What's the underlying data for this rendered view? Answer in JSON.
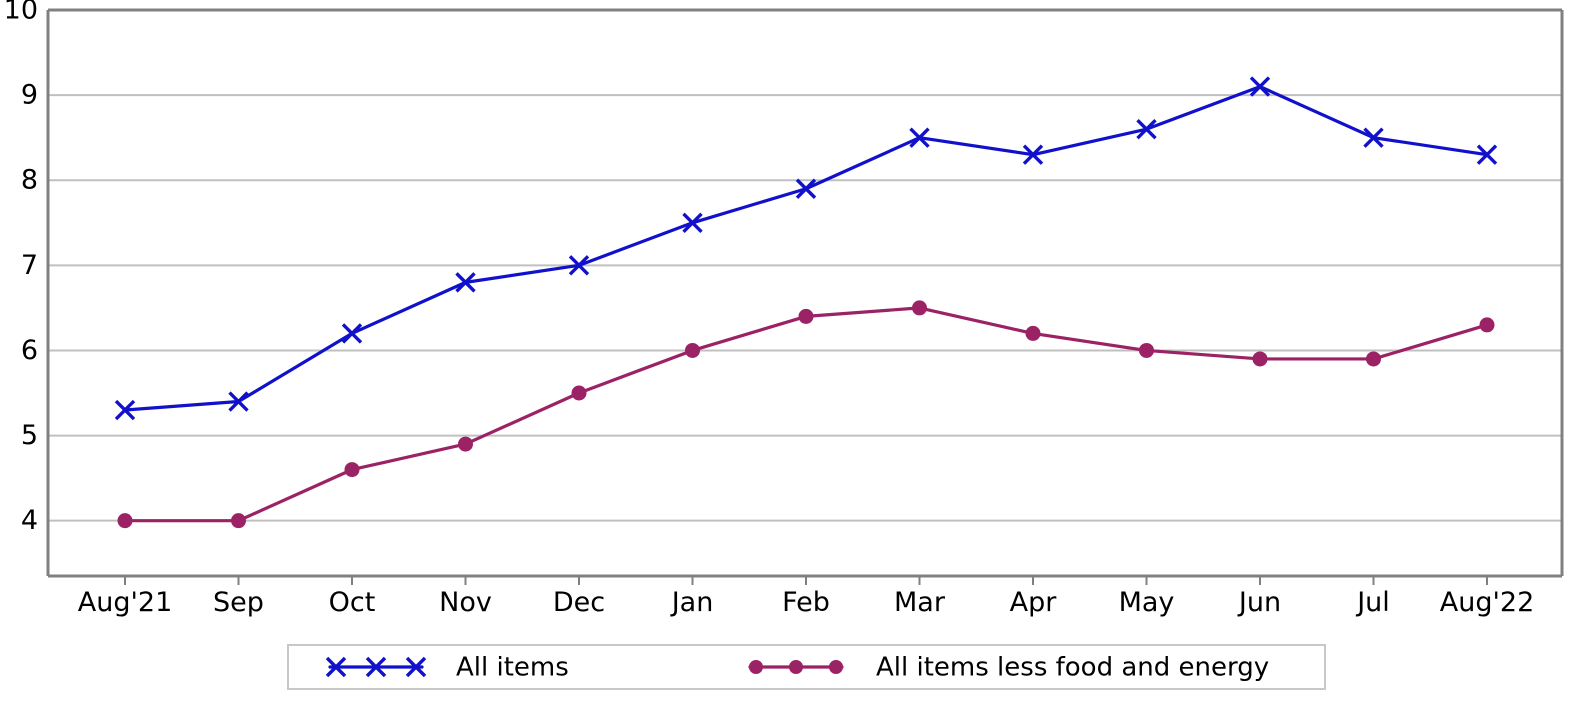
{
  "chart_data": {
    "type": "line",
    "title": "",
    "subtitle": "",
    "xlabel": "",
    "ylabel": "",
    "categories": [
      "Aug'21",
      "Sep",
      "Oct",
      "Nov",
      "Dec",
      "Jan",
      "Feb",
      "Mar",
      "Apr",
      "May",
      "Jun",
      "Jul",
      "Aug'22"
    ],
    "ylim": [
      3.35,
      10
    ],
    "ytick_labels": [
      "4",
      "5",
      "6",
      "7",
      "8",
      "9",
      "10"
    ],
    "yticks": [
      4,
      5,
      6,
      7,
      8,
      9,
      10
    ],
    "grid": "horizontal",
    "legend_position": "bottom",
    "series": [
      {
        "name": "All items",
        "color": "#1111CC",
        "marker": "x",
        "values": [
          5.3,
          5.4,
          6.2,
          6.8,
          7.0,
          7.5,
          7.9,
          8.5,
          8.3,
          8.6,
          9.1,
          8.5,
          8.3
        ]
      },
      {
        "name": "All items less food and energy",
        "color": "#9B2265",
        "marker": "circle",
        "values": [
          4.0,
          4.0,
          4.6,
          4.9,
          5.5,
          6.0,
          6.4,
          6.5,
          6.2,
          6.0,
          5.9,
          5.9,
          6.3
        ]
      }
    ]
  },
  "legend": {
    "items": [
      {
        "label": "All items"
      },
      {
        "label": "All items less food and energy"
      }
    ]
  }
}
